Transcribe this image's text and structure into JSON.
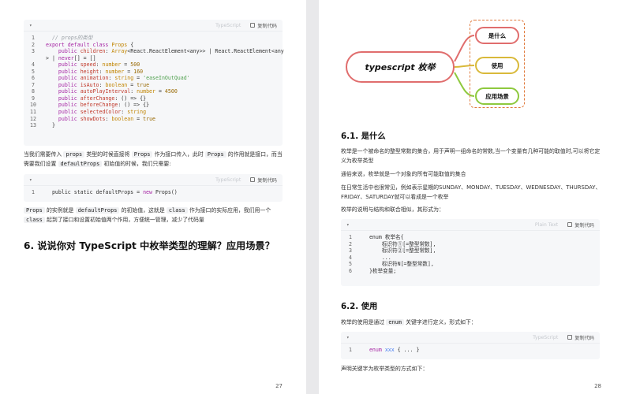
{
  "left_page": {
    "code1": {
      "lang": "TypeScript",
      "copy": "复制代码",
      "lines": [
        {
          "n": "1",
          "parts": [
            {
              "t": "  "
            },
            {
              "t": "// props的类型",
              "c": "cm"
            }
          ]
        },
        {
          "n": "2",
          "parts": [
            {
              "t": "export default class ",
              "c": "kw"
            },
            {
              "t": "Props",
              "c": "tp"
            },
            {
              "t": " {"
            }
          ]
        },
        {
          "n": "3",
          "parts": [
            {
              "t": "    "
            },
            {
              "t": "public ",
              "c": "kw"
            },
            {
              "t": "children",
              "c": "red"
            },
            {
              "t": ": "
            },
            {
              "t": "Array",
              "c": "tp"
            },
            {
              "t": "<React.ReactElement<any>> | React.ReactElement<any"
            }
          ]
        },
        {
          "n": "",
          "parts": [
            {
              "t": "> | "
            },
            {
              "t": "never",
              "c": "kw"
            },
            {
              "t": "[] = []"
            }
          ]
        },
        {
          "n": "4",
          "parts": [
            {
              "t": "    "
            },
            {
              "t": "public ",
              "c": "kw"
            },
            {
              "t": "speed",
              "c": "red"
            },
            {
              "t": ": "
            },
            {
              "t": "number",
              "c": "tp"
            },
            {
              "t": " = "
            },
            {
              "t": "500",
              "c": "nm"
            }
          ]
        },
        {
          "n": "5",
          "parts": [
            {
              "t": "    "
            },
            {
              "t": "public ",
              "c": "kw"
            },
            {
              "t": "height",
              "c": "red"
            },
            {
              "t": ": "
            },
            {
              "t": "number",
              "c": "tp"
            },
            {
              "t": " = "
            },
            {
              "t": "160",
              "c": "nm"
            }
          ]
        },
        {
          "n": "6",
          "parts": [
            {
              "t": "    "
            },
            {
              "t": "public ",
              "c": "kw"
            },
            {
              "t": "animation",
              "c": "red"
            },
            {
              "t": ": "
            },
            {
              "t": "string",
              "c": "tp"
            },
            {
              "t": " = "
            },
            {
              "t": "'easeInOutQuad'",
              "c": "st"
            }
          ]
        },
        {
          "n": "7",
          "parts": [
            {
              "t": "    "
            },
            {
              "t": "public ",
              "c": "kw"
            },
            {
              "t": "isAuto",
              "c": "red"
            },
            {
              "t": ": "
            },
            {
              "t": "boolean",
              "c": "tp"
            },
            {
              "t": " = "
            },
            {
              "t": "true",
              "c": "nm"
            }
          ]
        },
        {
          "n": "8",
          "parts": [
            {
              "t": "    "
            },
            {
              "t": "public ",
              "c": "kw"
            },
            {
              "t": "autoPlayInterval",
              "c": "red"
            },
            {
              "t": ": "
            },
            {
              "t": "number",
              "c": "tp"
            },
            {
              "t": " = "
            },
            {
              "t": "4500",
              "c": "nm"
            }
          ]
        },
        {
          "n": "9",
          "parts": [
            {
              "t": "    "
            },
            {
              "t": "public ",
              "c": "kw"
            },
            {
              "t": "afterChange",
              "c": "red"
            },
            {
              "t": ": () => {}"
            }
          ]
        },
        {
          "n": "10",
          "parts": [
            {
              "t": "    "
            },
            {
              "t": "public ",
              "c": "kw"
            },
            {
              "t": "beforeChange",
              "c": "red"
            },
            {
              "t": ": () => {}"
            }
          ]
        },
        {
          "n": "11",
          "parts": [
            {
              "t": "    "
            },
            {
              "t": "public ",
              "c": "kw"
            },
            {
              "t": "selectedColor",
              "c": "red"
            },
            {
              "t": ": "
            },
            {
              "t": "string",
              "c": "tp"
            }
          ]
        },
        {
          "n": "12",
          "parts": [
            {
              "t": "    "
            },
            {
              "t": "public ",
              "c": "kw"
            },
            {
              "t": "showDots",
              "c": "red"
            },
            {
              "t": ": "
            },
            {
              "t": "boolean",
              "c": "tp"
            },
            {
              "t": " = "
            },
            {
              "t": "true",
              "c": "nm"
            }
          ]
        },
        {
          "n": "13",
          "parts": [
            {
              "t": "  }"
            }
          ]
        }
      ]
    },
    "para1": [
      {
        "t": "当我们需要传入 "
      },
      {
        "t": "props",
        "c": "ic"
      },
      {
        "t": " 类型的时候直接将 "
      },
      {
        "t": "Props",
        "c": "ic"
      },
      {
        "t": " 作为接口传入，此时 "
      },
      {
        "t": "Props",
        "c": "ic"
      },
      {
        "t": " 的作用就是接口，而当需要我们设置 "
      },
      {
        "t": "defaultProps",
        "c": "ic"
      },
      {
        "t": " 初始值的时候，我们只需要:"
      }
    ],
    "code2": {
      "lang": "TypeScript",
      "copy": "复制代码",
      "lines": [
        {
          "n": "1",
          "parts": [
            {
              "t": "  public static defaultProps = "
            },
            {
              "t": "new ",
              "c": "kw"
            },
            {
              "t": "Props()"
            }
          ]
        }
      ]
    },
    "para2": [
      {
        "t": "Props",
        "c": "ic"
      },
      {
        "t": " 的实例就是 "
      },
      {
        "t": "defaultProps",
        "c": "ic"
      },
      {
        "t": " 的初始值，这就是 "
      },
      {
        "t": "class",
        "c": "ic"
      },
      {
        "t": " 作为接口的实际应用，我们用一个 "
      },
      {
        "t": "class",
        "c": "ic"
      },
      {
        "t": " 起到了接口和设置初始值两个作用，方便统一管理，减少了代码量"
      }
    ],
    "heading": "6. 说说你对 TypeScript 中枚举类型的理解？应用场景？",
    "page_number": "27"
  },
  "right_page": {
    "mindmap": {
      "root": "typescript 枚举",
      "nodes": [
        "是什么",
        "使用",
        "应用场景"
      ],
      "colors": {
        "root": "#e06d6d",
        "n1": "#e06d6d",
        "n2": "#d9b93a",
        "n3": "#8ec93e",
        "box": "#e07a3c"
      }
    },
    "h61": "6.1. 是什么",
    "p1": "枚举是一个被命名的整型常数的集合，用于声明一组命名的常数,当一个变量有几种可能的取值时,可以将它定义为枚举类型",
    "p2": "通俗来说，枚举就是一个对象的所有可能取值的集合",
    "p3": "在日常生活中也很常见，例如表示星期的SUNDAY、MONDAY、TUESDAY、WEDNESDAY、THURSDAY、FRIDAY、SATURDAY就可以看成是一个枚举",
    "p4": "枚举的说明与结构和联合相似，其形式为：",
    "code3": {
      "lang": "Plain Text",
      "copy": "复制代码",
      "lines": [
        {
          "n": "1",
          "parts": [
            {
              "t": "  enum 枚举名{"
            }
          ]
        },
        {
          "n": "2",
          "parts": [
            {
              "t": "      标识符①[=整型常数],"
            }
          ]
        },
        {
          "n": "3",
          "parts": [
            {
              "t": "      标识符②[=整型常数],"
            }
          ]
        },
        {
          "n": "4",
          "parts": [
            {
              "t": "      ..."
            }
          ]
        },
        {
          "n": "5",
          "parts": [
            {
              "t": "      标识符N[=整型常数],"
            }
          ]
        },
        {
          "n": "6",
          "parts": [
            {
              "t": "  }枚举变量;"
            }
          ]
        }
      ]
    },
    "h62": "6.2. 使用",
    "p5": [
      {
        "t": "枚举的使用是通过 "
      },
      {
        "t": "enum",
        "c": "ic"
      },
      {
        "t": " 关键字进行定义，形式如下："
      }
    ],
    "code4": {
      "lang": "TypeScript",
      "copy": "复制代码",
      "lines": [
        {
          "n": "1",
          "parts": [
            {
              "t": "  "
            },
            {
              "t": "enum ",
              "c": "kw"
            },
            {
              "t": "xxx",
              "c": "prop"
            },
            {
              "t": " { ... }"
            }
          ]
        }
      ]
    },
    "p6": "声明关键字为枚举类型的方式如下：",
    "page_number": "28"
  }
}
